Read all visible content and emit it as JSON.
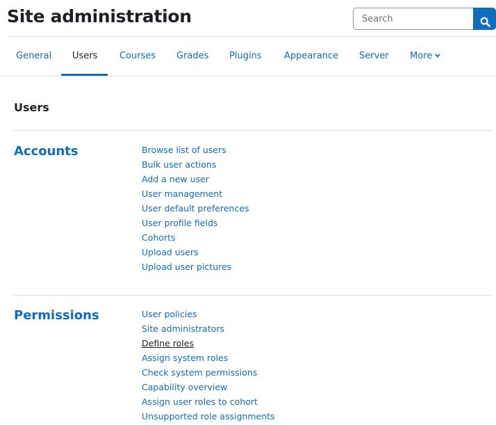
{
  "page": {
    "title": "Site administration"
  },
  "search": {
    "placeholder": "Search"
  },
  "tabs": [
    {
      "label": "General",
      "active": false
    },
    {
      "label": "Users",
      "active": true
    },
    {
      "label": "Courses",
      "active": false
    },
    {
      "label": "Grades",
      "active": false
    },
    {
      "label": "Plugins",
      "active": false
    },
    {
      "label": "Appearance",
      "active": false
    },
    {
      "label": "Server",
      "active": false
    },
    {
      "label": "More",
      "active": false,
      "icon": "chevron-down-icon"
    }
  ],
  "section": {
    "title": "Users"
  },
  "groups": [
    {
      "title": "Accounts",
      "links": [
        "Browse list of users",
        "Bulk user actions",
        "Add a new user",
        "User management",
        "User default preferences",
        "User profile fields",
        "Cohorts",
        "Upload users",
        "Upload user pictures"
      ]
    },
    {
      "title": "Permissions",
      "links": [
        "User policies",
        "Site administrators",
        "Define roles",
        "Assign system roles",
        "Check system permissions",
        "Capability overview",
        "Assign user roles to cohort",
        "Unsupported role assignments"
      ],
      "hovered_link": "Define roles"
    }
  ],
  "colors": {
    "link": "#0f6cbf",
    "text": "#1d2125",
    "divider": "#dee2e6",
    "search_button": "#0f6cbf"
  },
  "icons": {
    "search_button": "search-icon"
  }
}
